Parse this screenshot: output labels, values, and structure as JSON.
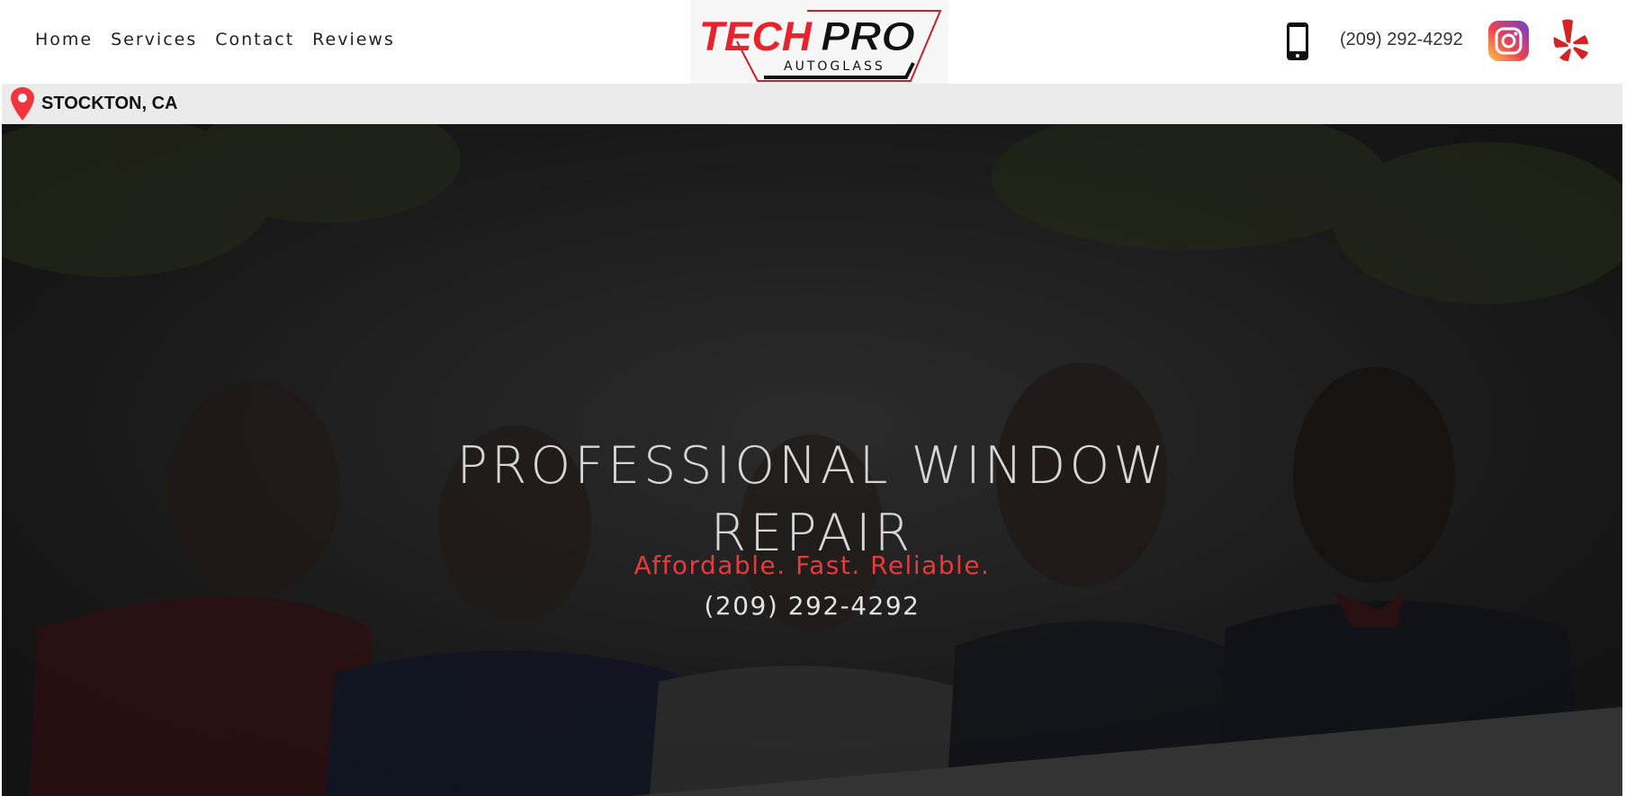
{
  "nav": {
    "items": [
      {
        "label": "Home"
      },
      {
        "label": "Services"
      },
      {
        "label": "Contact"
      },
      {
        "label": "Reviews"
      }
    ]
  },
  "logo": {
    "word1": "TECH",
    "word2": "PRO",
    "sub": "AUTOGLASS"
  },
  "header": {
    "phone": "(209) 292-4292"
  },
  "location": {
    "city": "STOCKTON, CA"
  },
  "hero": {
    "title_line1": "PROFESSIONAL WINDOW",
    "title_line2": "REPAIR",
    "tagline": "Affordable. Fast. Reliable.",
    "phone": "(209) 292-4292"
  },
  "colors": {
    "brand_red": "#e8393d",
    "hero_overlay": "#1d1d1f",
    "location_bar": "#ebebeb"
  },
  "icons": [
    "phone-icon",
    "instagram-icon",
    "yelp-icon",
    "location-pin-icon"
  ]
}
